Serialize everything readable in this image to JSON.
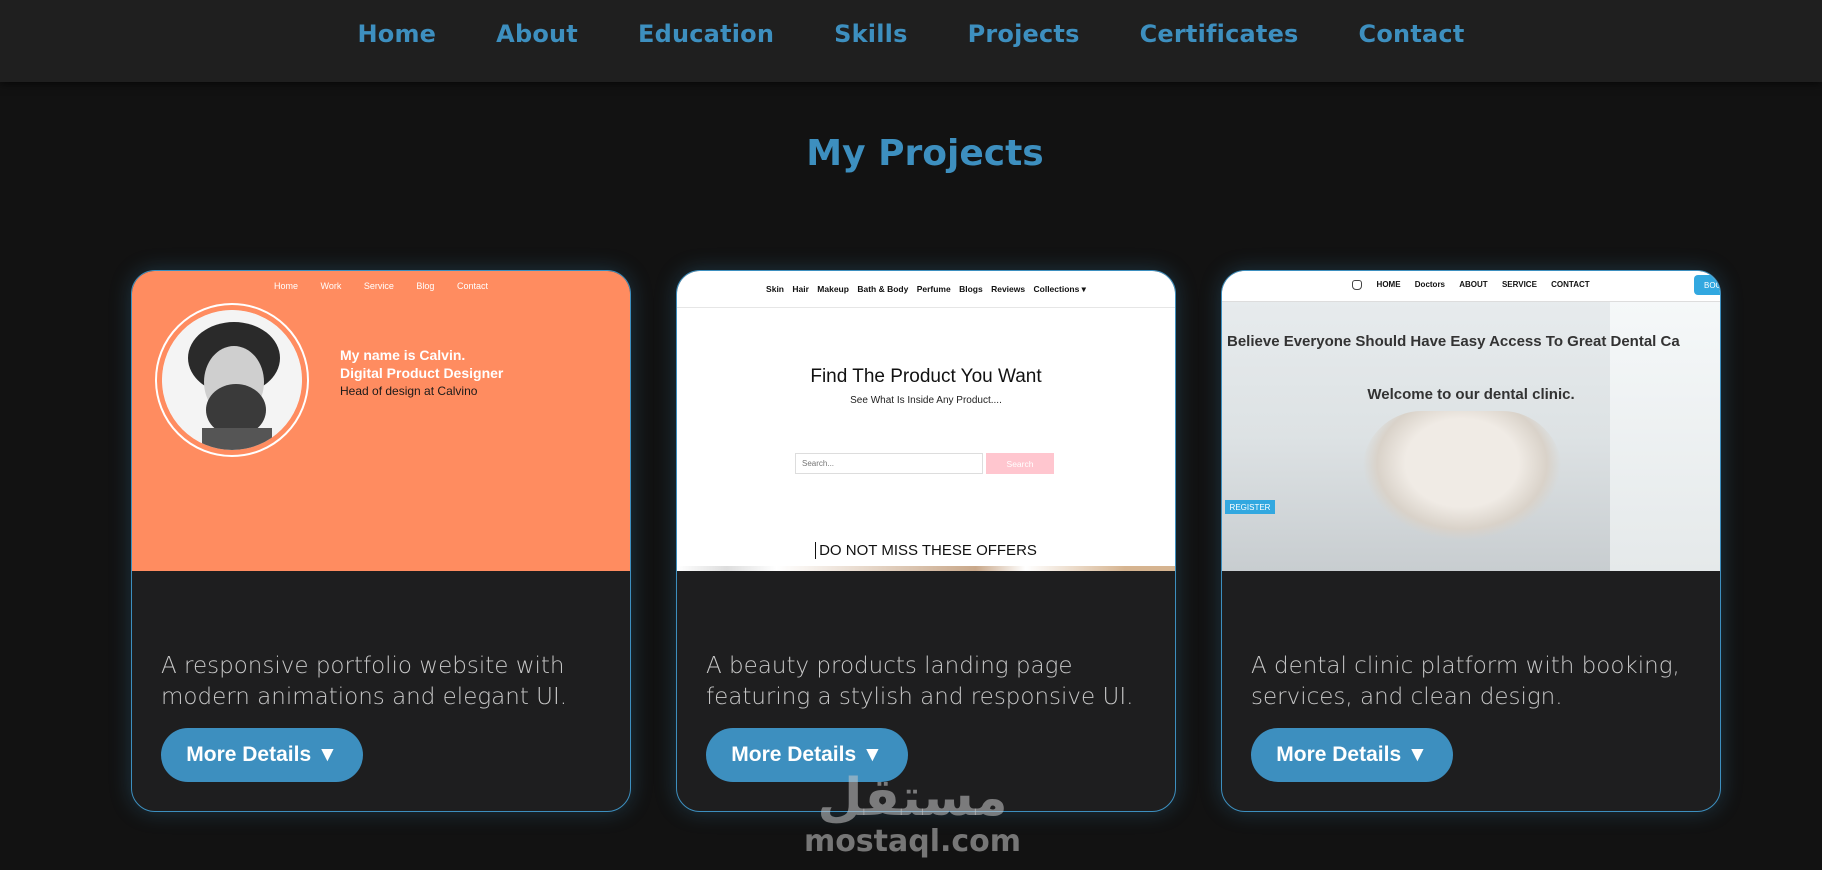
{
  "nav": {
    "items": [
      "Home",
      "About",
      "Education",
      "Skills",
      "Projects",
      "Certificates",
      "Contact"
    ]
  },
  "projects_section": {
    "title": "My Projects",
    "cards": [
      {
        "description": "A responsive portfolio website with modern animations and elegant UI.",
        "button_label": "More Details ▼",
        "preview": {
          "nav": [
            "Home",
            "Work",
            "Service",
            "Blog",
            "Contact"
          ],
          "name_line1": "My name is Calvin.",
          "name_line2": "Digital Product Designer",
          "subtitle": "Head of design at Calvino",
          "bg_color": "#ff8c60"
        }
      },
      {
        "description": "A beauty products landing page featuring a stylish and responsive UI.",
        "button_label": "More Details ▼",
        "preview": {
          "nav": [
            "Skin",
            "Hair",
            "Makeup",
            "Bath & Body",
            "Perfume",
            "Blogs",
            "Reviews",
            "Collections ▾"
          ],
          "heading": "Find The Product You Want",
          "subheading": "See What Is Inside Any Product....",
          "search_placeholder": "Search...",
          "search_button": "Search",
          "offers": "DO NOT MISS THESE OFFERS"
        }
      },
      {
        "description": "A dental clinic platform with booking, services, and clean design.",
        "button_label": "More Details ▼",
        "preview": {
          "nav": [
            "HOME",
            "Doctors",
            "ABOUT",
            "SERVICE",
            "CONTACT"
          ],
          "book_button": "BOO",
          "headline": "Believe Everyone Should Have Easy Access To Great Dental Ca",
          "welcome": "Welcome to our dental clinic.",
          "register_button": "REGISTER"
        }
      }
    ]
  },
  "watermark": {
    "arabic": "مستقل",
    "latin": "mostaql.com"
  },
  "colors": {
    "accent": "#3d8fbf",
    "background": "#121212",
    "card": "#1e1e1f"
  }
}
